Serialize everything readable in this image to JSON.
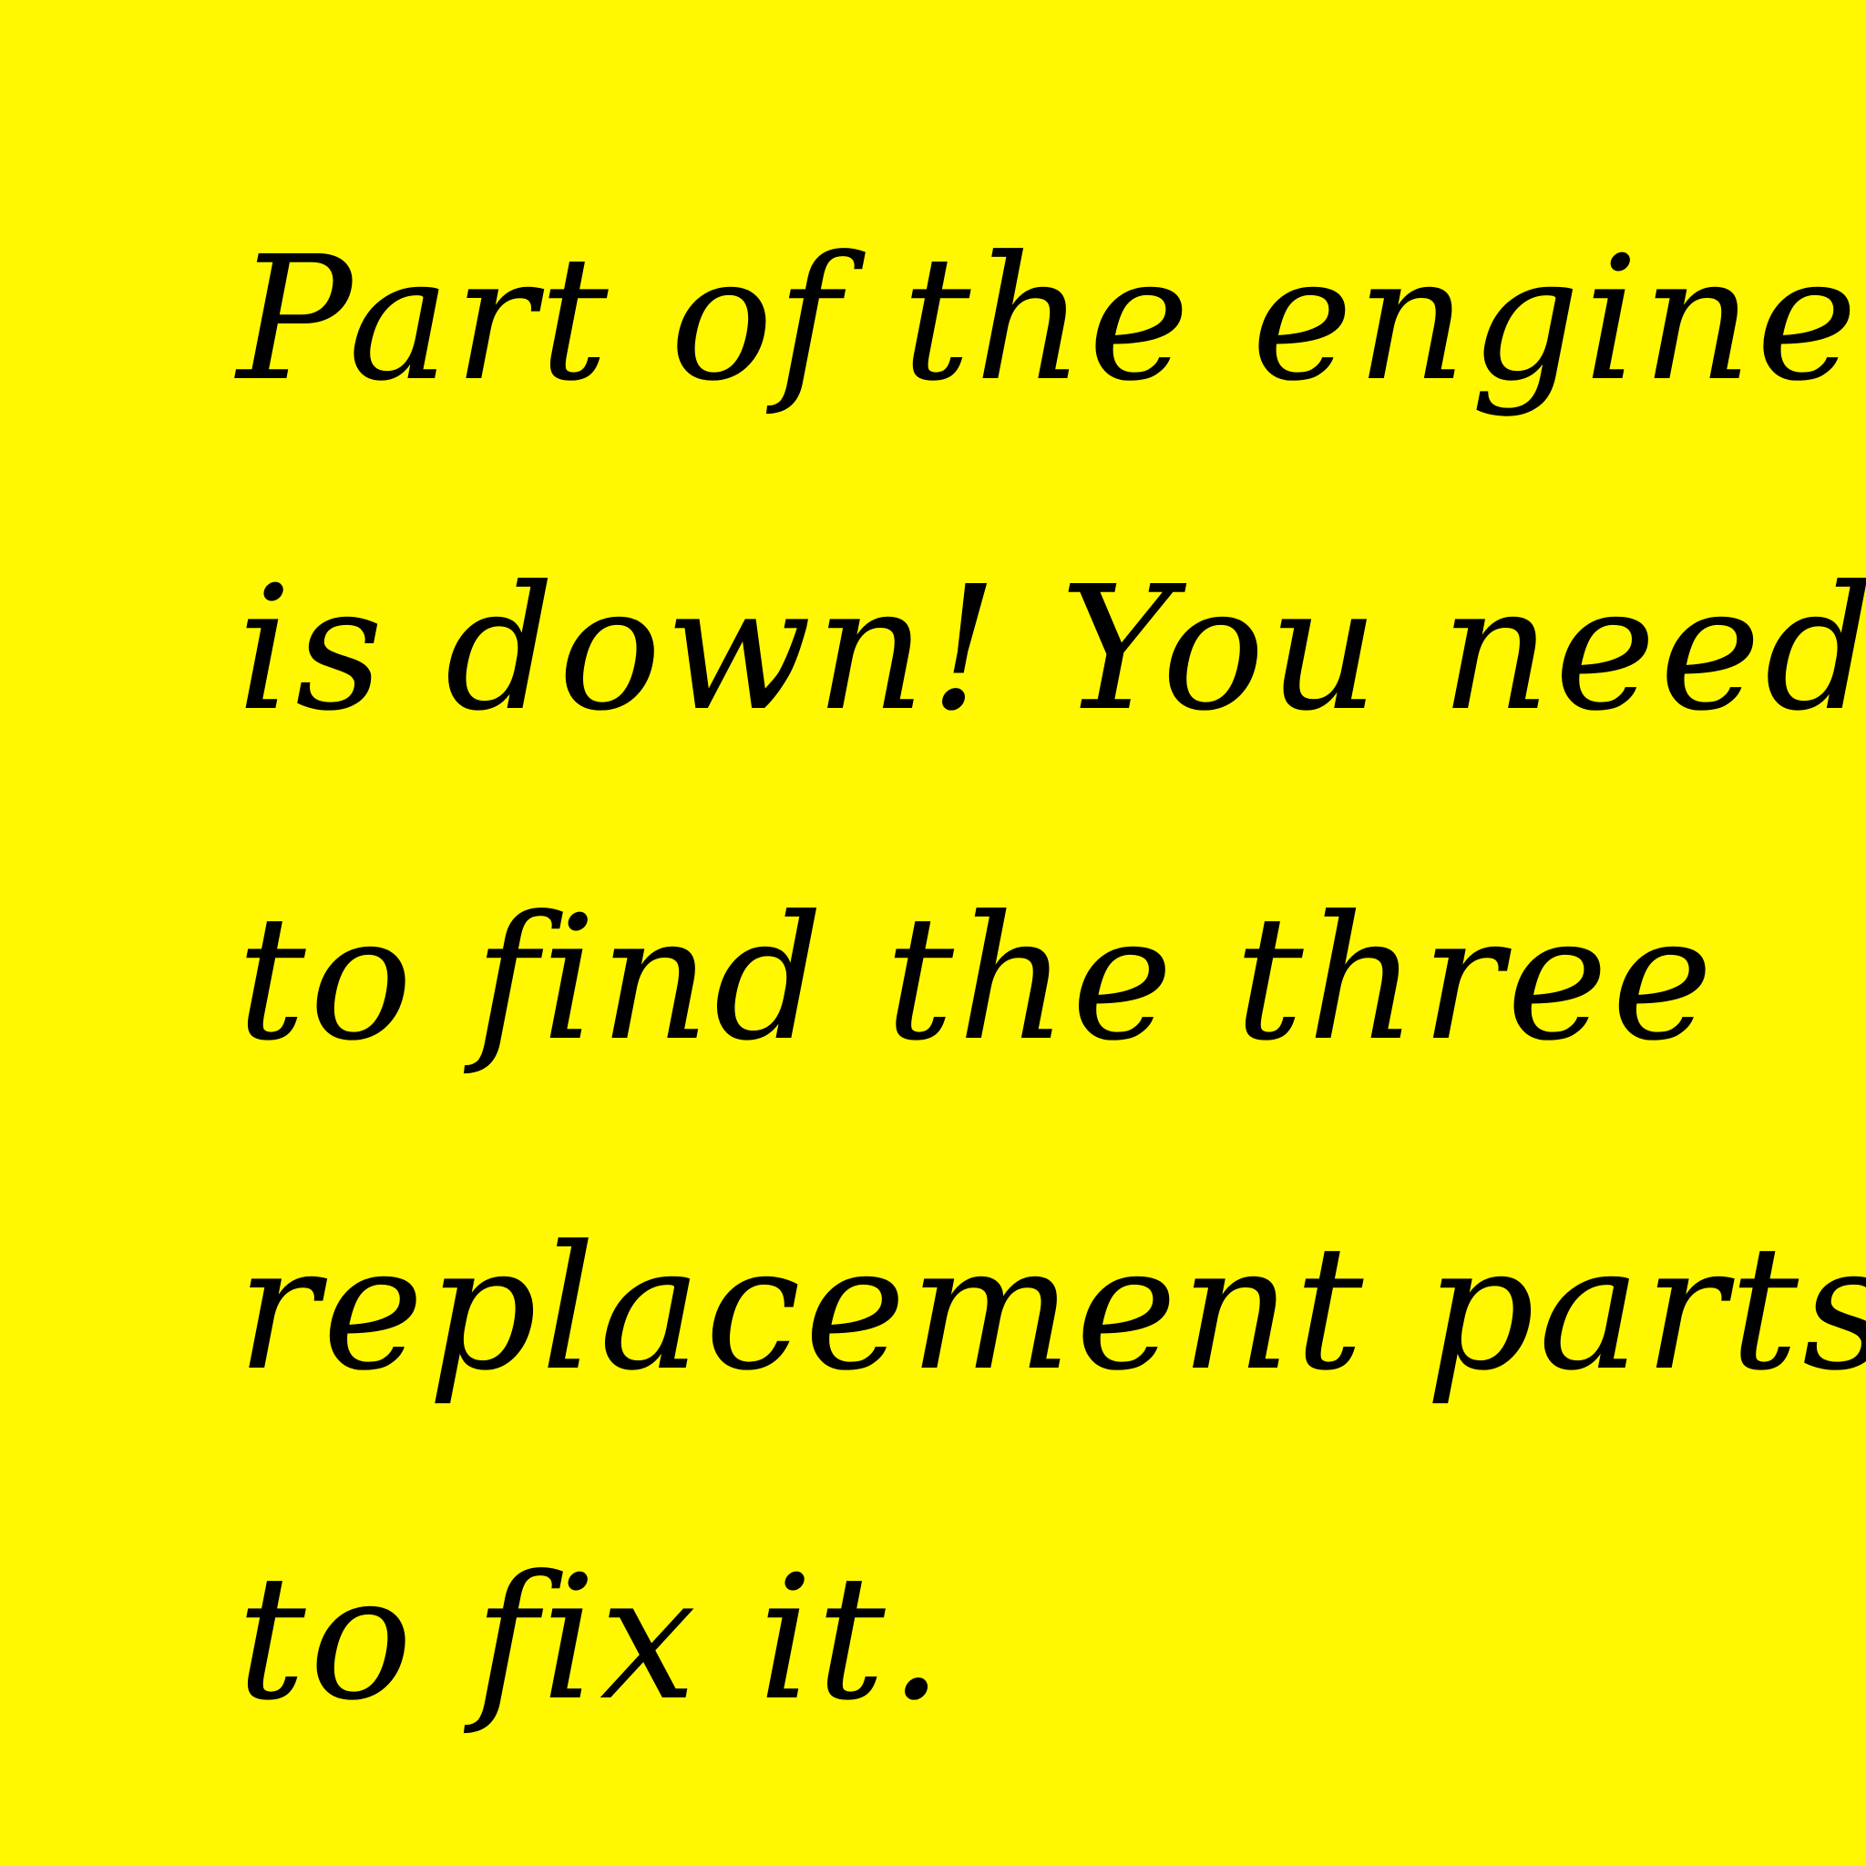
{
  "colors": {
    "background": "#FFF800",
    "text": "#000000"
  },
  "message": {
    "lines": [
      "Part of the engine",
      "is down! You need",
      "to find the three",
      "replacement parts",
      "to fix it."
    ]
  }
}
